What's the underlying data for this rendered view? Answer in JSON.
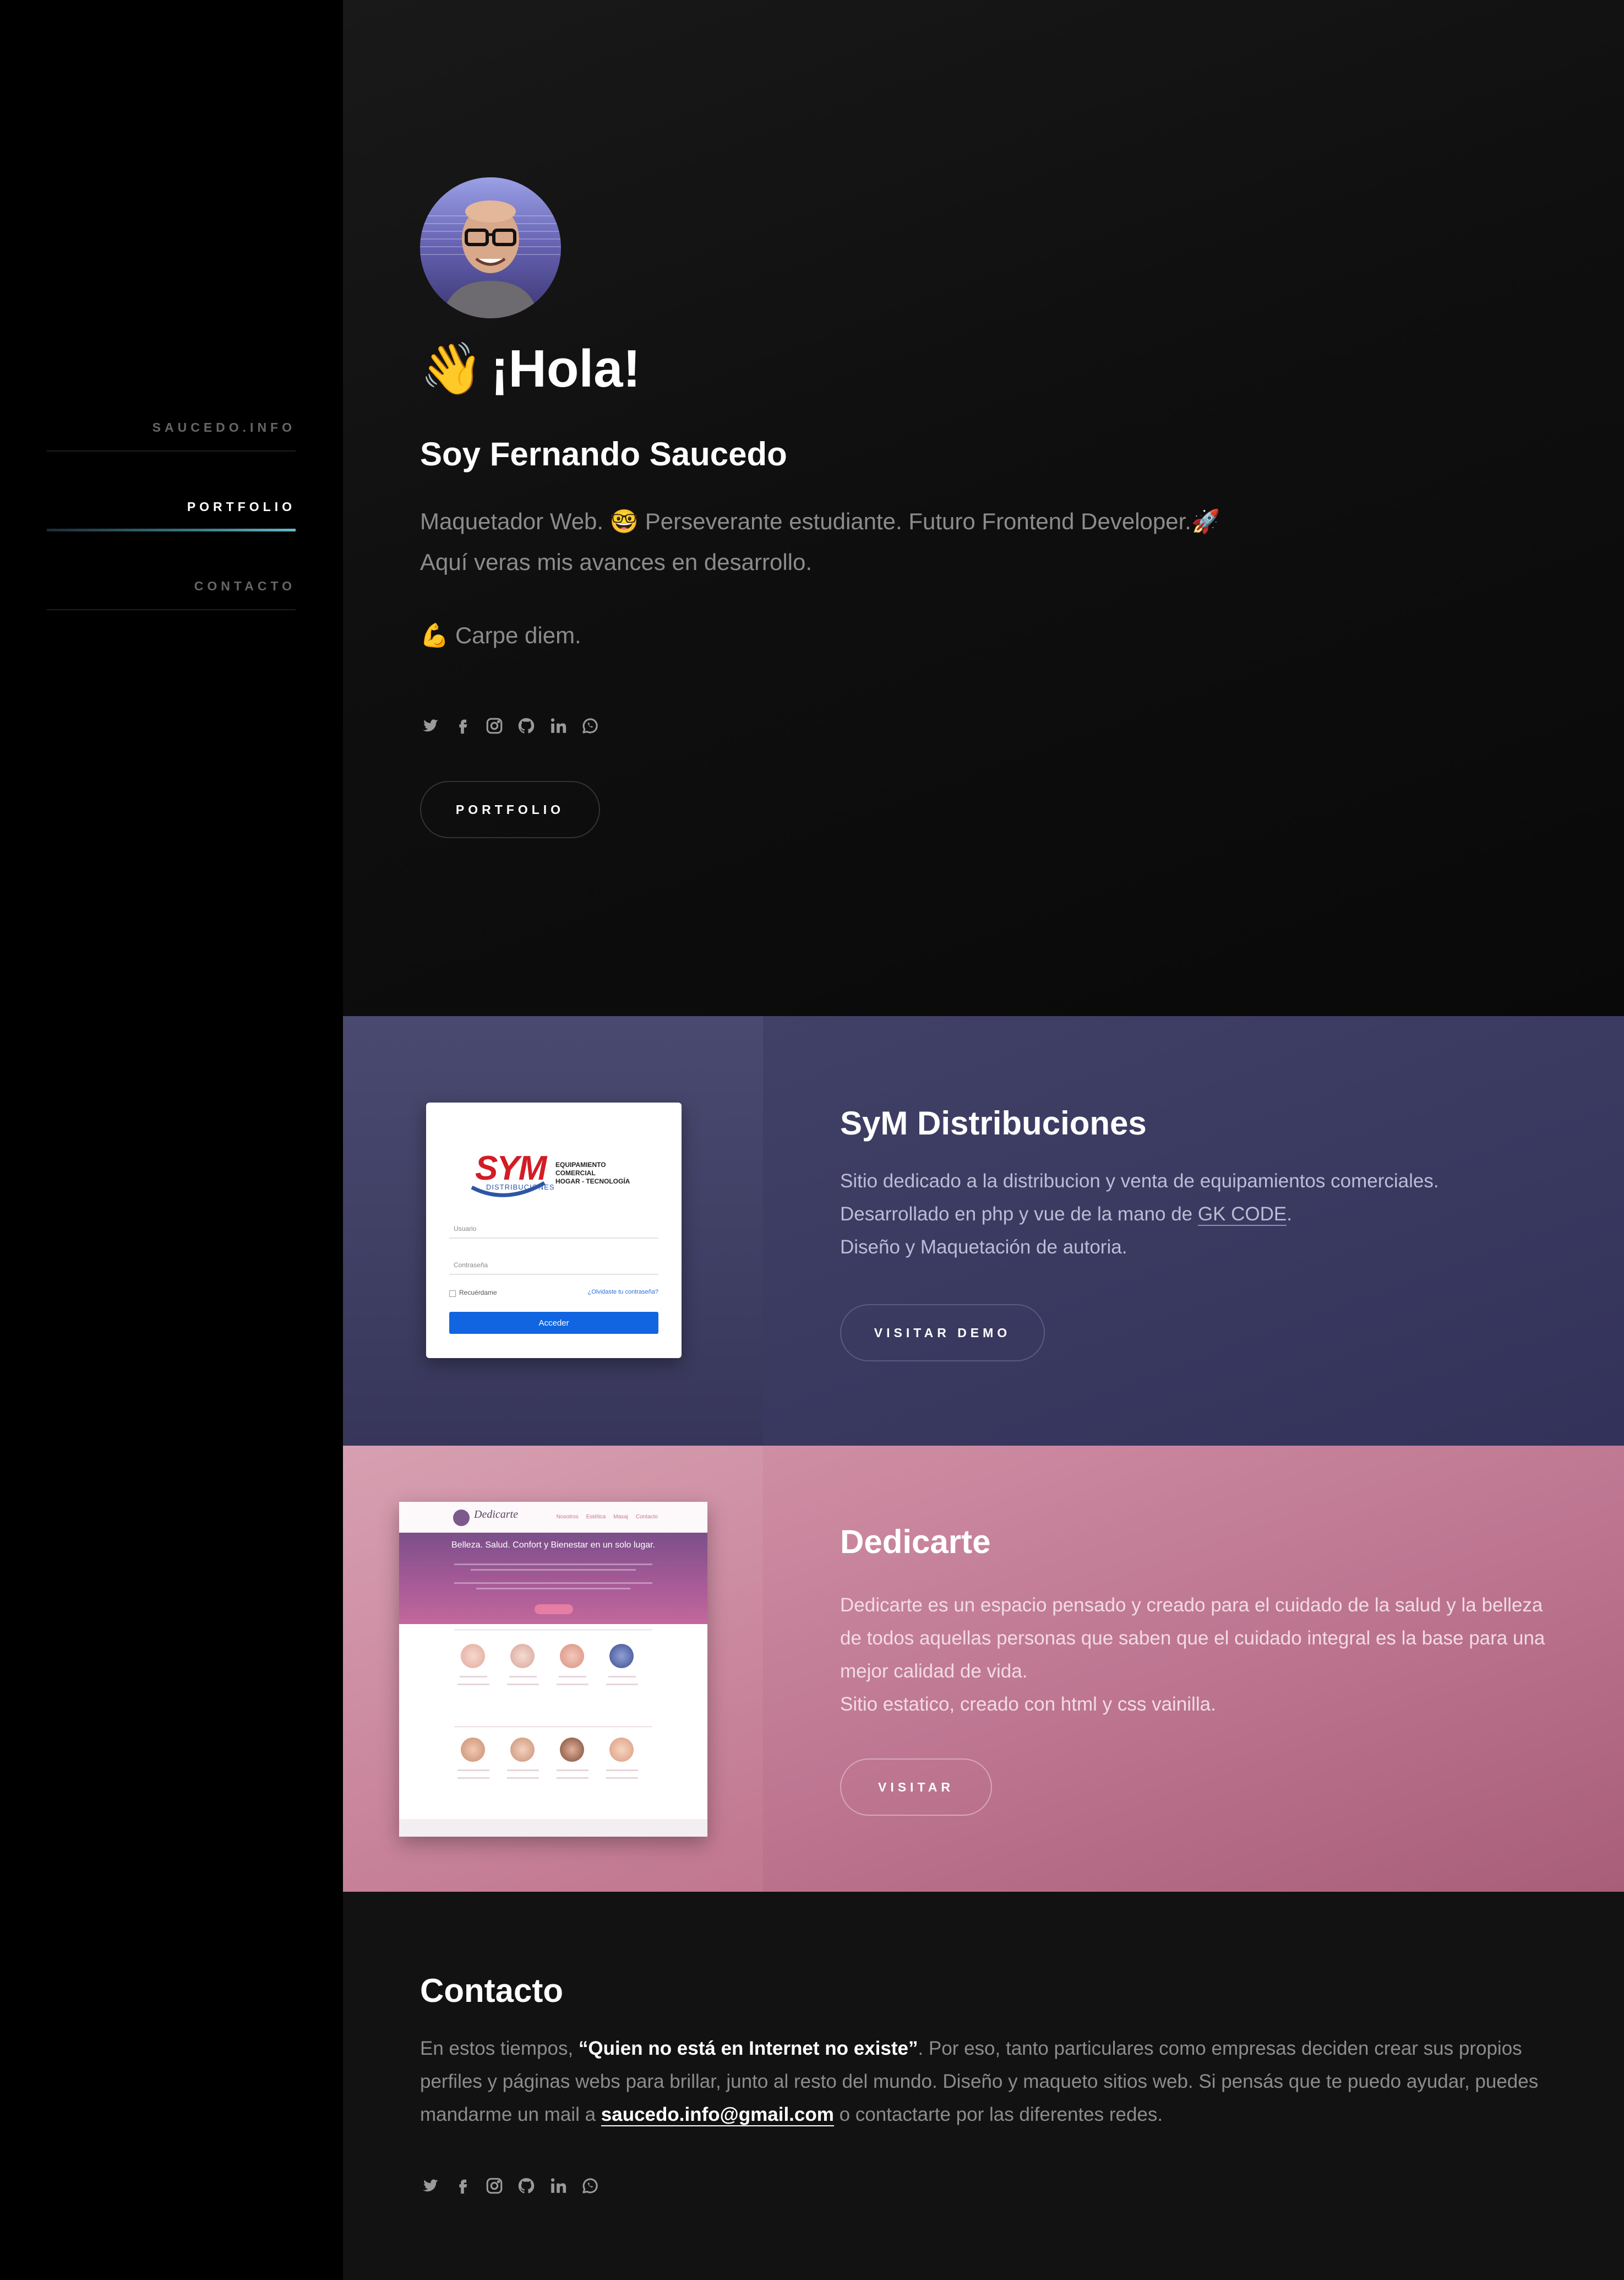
{
  "nav": {
    "items": [
      {
        "label": "SAUCEDO.INFO",
        "active": false
      },
      {
        "label": "PORTFOLIO",
        "active": true
      },
      {
        "label": "CONTACTO",
        "active": false
      }
    ]
  },
  "hero": {
    "avatar_alt": "Fernando Saucedo",
    "wave_emoji": "👋",
    "greeting": "¡Hola!",
    "name": "Soy Fernando Saucedo",
    "desc_line1": "Maquetador Web. 🤓 Perseverante estudiante. Futuro Frontend Developer.🚀",
    "desc_line2": "Aquí veras mis avances en desarrollo.",
    "motto": "💪 Carpe diem.",
    "social_icons": [
      "twitter-icon",
      "facebook-icon",
      "instagram-icon",
      "github-icon",
      "linkedin-icon",
      "whatsapp-icon"
    ],
    "button_label": "PORTFOLIO"
  },
  "projects": [
    {
      "title": "SyM Distribuciones",
      "desc_1": "Sitio dedicado a la distribucion y venta de equipamientos comerciales.",
      "desc_2_prefix": "Desarrollado en php y vue de la mano de ",
      "desc_2_link": "GK CODE",
      "desc_2_suffix": ".",
      "desc_3": "Diseño y Maquetación de autoria.",
      "button_label": "VISITAR DEMO",
      "thumb": {
        "logo": "SYM",
        "logo_sub": "DISTRIBUCIONES",
        "logo_right_1": "EQUIPAMIENTO COMERCIAL",
        "logo_right_2": "HOGAR - TECNOLOGÍA",
        "user_label": "Usuario",
        "pass_label": "Contraseña",
        "remember": "Recuérdame",
        "forgot": "¿Olvidaste tu contraseña?",
        "login": "Acceder"
      }
    },
    {
      "title": "Dedicarte",
      "desc_1": "Dedicarte es un espacio pensado y creado para el cuidado de la salud y la belleza de todos aquellas personas que saben que el cuidado integral es la base para una mejor calidad de vida.",
      "desc_2": "Sitio estatico, creado con html y css vainilla.",
      "button_label": "VISITAR",
      "thumb": {
        "logo": "Dedicarte",
        "menu": [
          "Nosotros",
          "Estética",
          "Masaj",
          "Contacto"
        ],
        "banner_title": "Belleza. Salud. Confort y Bienestar en un solo lugar."
      }
    }
  ],
  "contact": {
    "title": "Contacto",
    "text_1": "En estos tiempos, ",
    "quote": "“Quien no está en Internet no existe”",
    "text_2": ". Por eso, tanto particulares como empresas deciden crear sus propios perfiles y páginas webs para brillar, junto al resto del mundo. Diseño y maqueto sitios web. Si pensás que te puedo ayudar, puedes mandarme un mail a ",
    "email": "saucedo.info@gmail.com",
    "text_3": " o contactarte por las diferentes redes."
  },
  "colors": {
    "accent_gradient_end": "#66b9c4",
    "sym_bg": "#3b3a5d",
    "dedicarte_bg": "#c98a9f",
    "contact_bg": "#121212"
  }
}
